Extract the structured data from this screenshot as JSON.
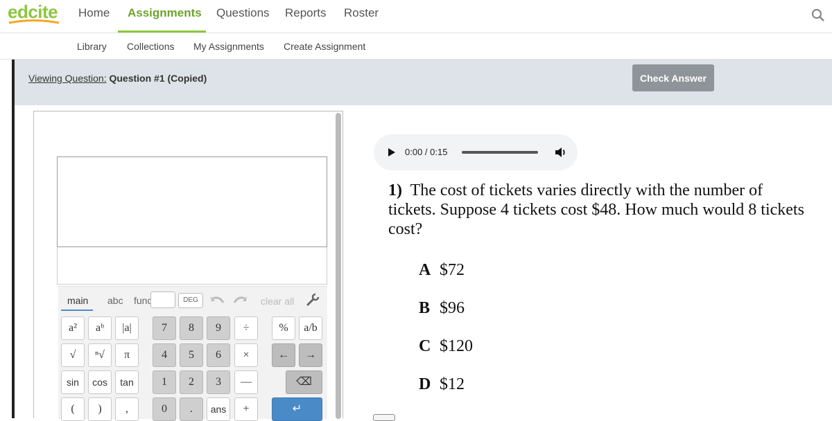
{
  "brand": {
    "name": "edcite",
    "color": "#8cc63f"
  },
  "nav": {
    "items": [
      "Home",
      "Assignments",
      "Questions",
      "Reports",
      "Roster"
    ],
    "active": "Assignments"
  },
  "subnav": {
    "items": [
      "Library",
      "Collections",
      "My Assignments",
      "Create Assignment"
    ]
  },
  "viewbar": {
    "prefix": "Viewing Question:",
    "title": "Question #1 (Copied)",
    "check_button": "Check Answer"
  },
  "calculator": {
    "tabs": [
      "main",
      "abc",
      "func"
    ],
    "active_tab": "main",
    "angle_mode": "DEG",
    "clear_label": "clear all",
    "keys": {
      "row1": [
        "a²",
        "aᵇ",
        "|a|",
        "7",
        "8",
        "9",
        "÷",
        "%",
        "a/b"
      ],
      "row2": [
        "√",
        "ⁿ√",
        "π",
        "4",
        "5",
        "6",
        "×",
        "←",
        "→"
      ],
      "row3": [
        "sin",
        "cos",
        "tan",
        "1",
        "2",
        "3",
        "—",
        "⌫"
      ],
      "row4": [
        "(",
        ")",
        ",",
        "0",
        ".",
        "ans",
        "+",
        "↵"
      ]
    }
  },
  "audio": {
    "time": "0:00 / 0:15"
  },
  "question": {
    "number": "1)",
    "text": "The cost of tickets varies directly with the number of tickets. Suppose 4 tickets cost $48. How much would 8 tickets cost?",
    "choices": [
      {
        "letter": "A",
        "value": "$72"
      },
      {
        "letter": "B",
        "value": "$96"
      },
      {
        "letter": "C",
        "value": "$120"
      },
      {
        "letter": "D",
        "value": "$12"
      }
    ]
  }
}
